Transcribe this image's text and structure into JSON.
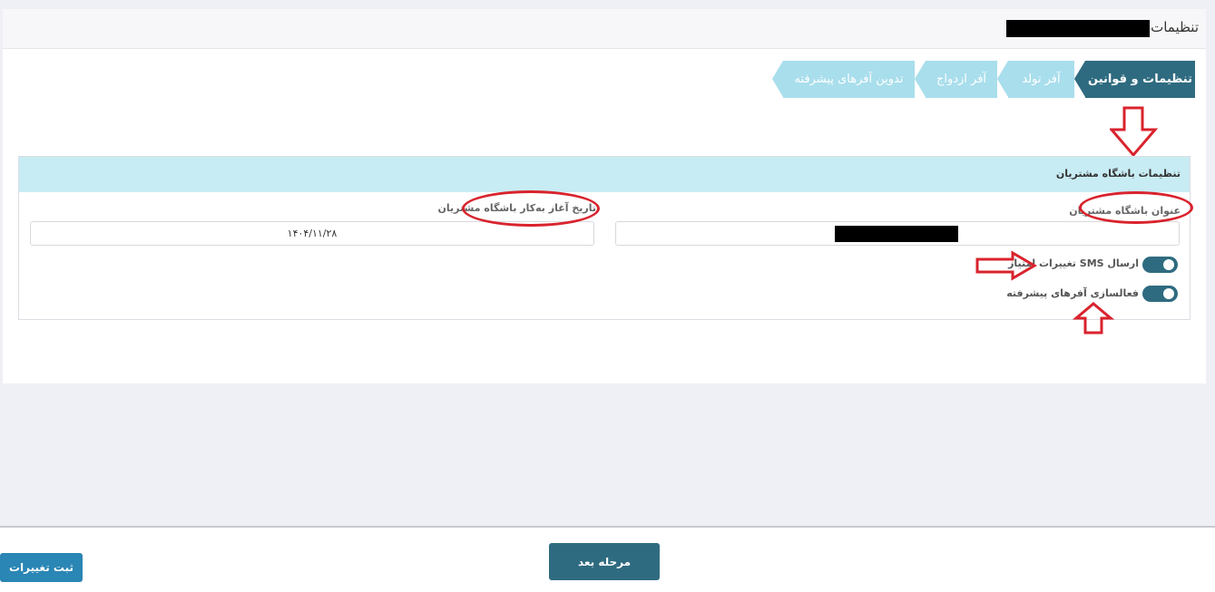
{
  "header": {
    "title": "تنظیمات"
  },
  "wizard": {
    "steps": [
      {
        "label": "تنظیمات و قوانین",
        "state": "active"
      },
      {
        "label": "آفر تولد",
        "state": "idle"
      },
      {
        "label": "آفر ازدواج",
        "state": "idle"
      },
      {
        "label": "تدوین آفرهای پیشرفته",
        "state": "idle"
      }
    ]
  },
  "panel": {
    "title": "تنظیمات باشگاه مشتریان",
    "club_name_label": "عنوان باشگاه مشتریان",
    "club_name_value": "",
    "start_date_label": "تاریخ آغاز به‌کار باشگاه مشتریان",
    "start_date_value": "۱۴۰۴/۱۱/۲۸",
    "toggles": [
      {
        "label": "ارسال SMS تغییرات امتیاز",
        "on": true
      },
      {
        "label": "فعالسازی آفرهای پیشرفته",
        "on": true
      }
    ]
  },
  "footer": {
    "next_label": "مرحله بعد",
    "save_label": "ثبت تغییرات"
  },
  "colors": {
    "accent": "#2f6b80",
    "step_idle": "#a9deec",
    "panel_head": "#c8ecf4",
    "save_button": "#2a86b4",
    "annotation": "#d9232d"
  }
}
